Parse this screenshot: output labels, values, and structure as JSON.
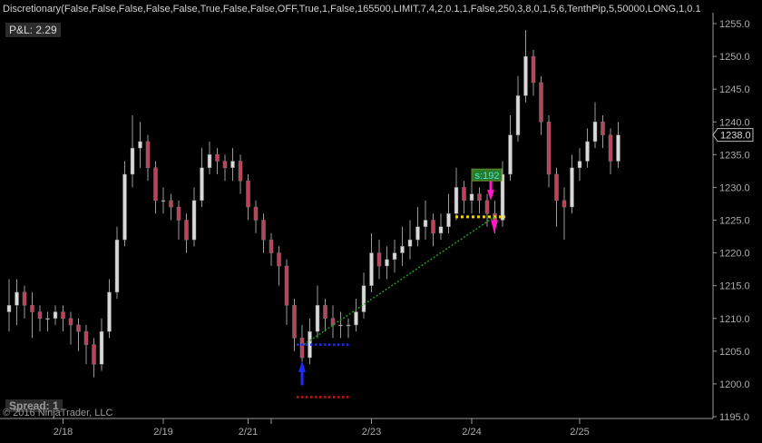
{
  "header": {
    "title": "Discretionary(False,False,False,False,False,True,False,False,OFF,True,1,False,165500,LIMIT,7,4,2,0.1,1,False,250,3,8,0,1,5,6,TenthPip,5,50000,LONG,1,0.1",
    "pnl": "P&L: 2.29",
    "spread": "Spread: 1",
    "copyright": "© 2016 NinjaTrader, LLC"
  },
  "colors": {
    "up": "#d9d9d9",
    "down": "#c0405a",
    "wick": "#9a9a9a",
    "entry": "#1e2bff",
    "stop": "#cc1111",
    "target": "#e8d21a",
    "trend": "#1f9a1f",
    "signal": "#ff19c8"
  },
  "chart_data": {
    "type": "candlestick",
    "ylim": [
      1195,
      1255
    ],
    "yticks": [
      "1195.0",
      "1200.0",
      "1205.0",
      "1210.0",
      "1215.0",
      "1220.0",
      "1225.0",
      "1230.0",
      "1235.0",
      "1240.0",
      "1245.0",
      "1250.0",
      "1255.0"
    ],
    "xticks": [
      {
        "label": "2/18",
        "bar": 7
      },
      {
        "label": "2/19",
        "bar": 20
      },
      {
        "label": "2/21",
        "bar": 31
      },
      {
        "label": "",
        "bar": 34
      },
      {
        "label": "2/23",
        "bar": 47
      },
      {
        "label": "2/24",
        "bar": 60
      },
      {
        "label": "2/25",
        "bar": 74
      }
    ],
    "last_price": "1238.0",
    "last_value": 1238,
    "ohlc": [
      [
        1211,
        1216,
        1208,
        1212
      ],
      [
        1212,
        1216,
        1209,
        1214
      ],
      [
        1214,
        1215,
        1210,
        1212
      ],
      [
        1212,
        1214,
        1207,
        1211
      ],
      [
        1211,
        1212,
        1208,
        1210
      ],
      [
        1210,
        1211,
        1208,
        1210
      ],
      [
        1210,
        1212,
        1209,
        1211
      ],
      [
        1211,
        1212,
        1208,
        1210
      ],
      [
        1210,
        1211,
        1206,
        1209
      ],
      [
        1209,
        1210,
        1205,
        1208
      ],
      [
        1208,
        1209,
        1203,
        1206
      ],
      [
        1206,
        1207,
        1201,
        1203
      ],
      [
        1203,
        1210,
        1202,
        1208
      ],
      [
        1208,
        1216,
        1207,
        1214
      ],
      [
        1214,
        1224,
        1213,
        1222
      ],
      [
        1222,
        1234,
        1221,
        1232
      ],
      [
        1232,
        1241,
        1230,
        1236
      ],
      [
        1236,
        1240,
        1233,
        1237
      ],
      [
        1237,
        1238,
        1231,
        1233
      ],
      [
        1233,
        1234,
        1226,
        1228
      ],
      [
        1228,
        1230,
        1226,
        1228
      ],
      [
        1228,
        1229,
        1225,
        1227
      ],
      [
        1227,
        1228,
        1222,
        1225
      ],
      [
        1225,
        1226,
        1220,
        1222
      ],
      [
        1222,
        1230,
        1221,
        1228
      ],
      [
        1228,
        1236,
        1227,
        1233
      ],
      [
        1233,
        1237,
        1232,
        1235
      ],
      [
        1235,
        1236,
        1232,
        1234
      ],
      [
        1234,
        1235,
        1231,
        1233
      ],
      [
        1233,
        1236,
        1231,
        1234
      ],
      [
        1234,
        1235,
        1229,
        1231
      ],
      [
        1231,
        1232,
        1225,
        1227
      ],
      [
        1227,
        1228,
        1223,
        1225
      ],
      [
        1225,
        1226,
        1220,
        1222
      ],
      [
        1222,
        1223,
        1218,
        1220
      ],
      [
        1220,
        1221,
        1215,
        1218
      ],
      [
        1218,
        1219,
        1209,
        1212
      ],
      [
        1212,
        1213,
        1205,
        1207
      ],
      [
        1207,
        1209,
        1202,
        1204
      ],
      [
        1204,
        1210,
        1203,
        1208
      ],
      [
        1208,
        1215,
        1207,
        1212
      ],
      [
        1212,
        1213,
        1208,
        1210
      ],
      [
        1210,
        1212,
        1207,
        1209
      ],
      [
        1209,
        1211,
        1207,
        1209
      ],
      [
        1209,
        1210,
        1207,
        1209
      ],
      [
        1209,
        1213,
        1208,
        1211
      ],
      [
        1211,
        1217,
        1210,
        1215
      ],
      [
        1215,
        1223,
        1214,
        1220
      ],
      [
        1220,
        1222,
        1216,
        1218
      ],
      [
        1218,
        1221,
        1216,
        1219
      ],
      [
        1219,
        1222,
        1217,
        1220
      ],
      [
        1220,
        1224,
        1218,
        1221
      ],
      [
        1221,
        1225,
        1219,
        1222
      ],
      [
        1222,
        1227,
        1221,
        1224
      ],
      [
        1224,
        1228,
        1222,
        1225
      ],
      [
        1225,
        1226,
        1221,
        1223
      ],
      [
        1223,
        1226,
        1222,
        1224
      ],
      [
        1224,
        1229,
        1223,
        1226
      ],
      [
        1226,
        1233,
        1225,
        1230
      ],
      [
        1230,
        1231,
        1226,
        1228
      ],
      [
        1228,
        1231,
        1226,
        1229
      ],
      [
        1229,
        1230,
        1226,
        1228
      ],
      [
        1228,
        1229,
        1224,
        1226
      ],
      [
        1226,
        1228,
        1223,
        1225
      ],
      [
        1225,
        1234,
        1224,
        1232
      ],
      [
        1232,
        1241,
        1231,
        1238
      ],
      [
        1238,
        1247,
        1237,
        1244
      ],
      [
        1244,
        1254,
        1243,
        1250
      ],
      [
        1250,
        1251,
        1244,
        1246
      ],
      [
        1246,
        1247,
        1238,
        1240
      ],
      [
        1240,
        1241,
        1230,
        1232
      ],
      [
        1232,
        1233,
        1224,
        1228
      ],
      [
        1228,
        1230,
        1222,
        1227
      ],
      [
        1227,
        1235,
        1226,
        1233
      ],
      [
        1233,
        1236,
        1231,
        1234
      ],
      [
        1234,
        1239,
        1233,
        1237
      ],
      [
        1237,
        1243,
        1236,
        1240
      ],
      [
        1240,
        1241,
        1236,
        1238
      ],
      [
        1238,
        1239,
        1232,
        1234
      ],
      [
        1234,
        1240,
        1233,
        1238
      ]
    ],
    "entry_level": 1206,
    "stop_level": 1198,
    "target_level": 1225.5,
    "entry_bar": 38,
    "signal_bar": 62,
    "signal_label": "s:192"
  }
}
